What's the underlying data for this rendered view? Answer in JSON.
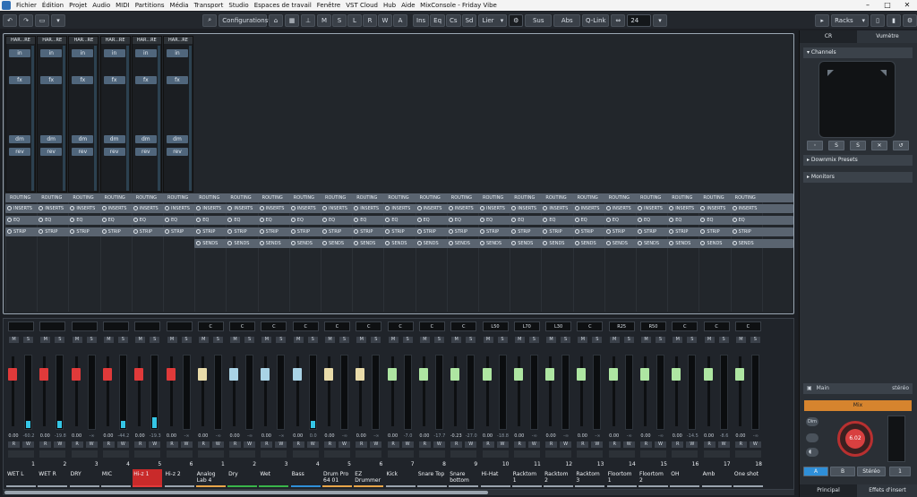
{
  "title_bar": {
    "menu": [
      "Fichier",
      "Édition",
      "Projet",
      "Audio",
      "MIDI",
      "Partitions",
      "Média",
      "Transport",
      "Studio",
      "Espaces de travail",
      "Fenêtre",
      "VST Cloud",
      "Hub",
      "Aide"
    ],
    "window_title": "MixConsole - Friday Vibe",
    "controls": [
      "–",
      "□",
      "✕"
    ]
  },
  "toolbar": {
    "undo": "↶",
    "redo": "↷",
    "configurations_label": "Configurations",
    "filter_buttons": [
      "M",
      "S",
      "L",
      "R",
      "W",
      "A"
    ],
    "section_buttons": [
      "Ins",
      "Eq",
      "Cs",
      "Sd"
    ],
    "link_label": "Lier",
    "sus_label": "Sus",
    "abs_label": "Abs",
    "qlink_label": "Q-Link",
    "channel_width": "24",
    "racks_label": "Racks"
  },
  "upper": {
    "strip_header": "HAR...RE",
    "in_label": "in",
    "fx_label": "fx",
    "dm_label": "dm",
    "rev_label": "rev",
    "routing_label": "ROUTING",
    "inserts_label": "INSERTS",
    "eq_label": "EQ",
    "strip_label": "STRIP",
    "sends_label": "SENDS"
  },
  "channels": [
    {
      "name": "WET L",
      "num": "1",
      "pan": "",
      "fader": "red",
      "meter": 0.1,
      "vol": "0.00",
      "peak": "-60.2",
      "color": "#9aa4ae"
    },
    {
      "name": "WET R",
      "num": "2",
      "pan": "",
      "fader": "red",
      "meter": 0.1,
      "vol": "0.00",
      "peak": "-19.8",
      "color": "#9aa4ae"
    },
    {
      "name": "DRY",
      "num": "3",
      "pan": "",
      "fader": "red",
      "meter": 0,
      "vol": "0.00",
      "peak": "-∞",
      "color": "#9aa4ae"
    },
    {
      "name": "MIC",
      "num": "4",
      "pan": "",
      "fader": "red",
      "meter": 0.1,
      "vol": "0.00",
      "peak": "-44.2",
      "color": "#9aa4ae"
    },
    {
      "name": "Hi-z 1",
      "num": "5",
      "pan": "",
      "fader": "red",
      "meter": 0.15,
      "vol": "0.00",
      "peak": "-19.3",
      "color": "#e23a3a"
    },
    {
      "name": "Hi-z 2",
      "num": "6",
      "pan": "",
      "fader": "red",
      "meter": 0,
      "vol": "0.00",
      "peak": "-∞",
      "color": "#9aa4ae"
    },
    {
      "name": "Analog Lab 4",
      "num": "1",
      "pan": "C",
      "fader": "beige",
      "meter": 0,
      "vol": "0.00",
      "peak": "-∞",
      "color": "#e8a64a"
    },
    {
      "name": "Dry",
      "num": "2",
      "pan": "C",
      "fader": "ltblue",
      "meter": 0,
      "vol": "0.00",
      "peak": "-∞",
      "color": "#39b54a"
    },
    {
      "name": "Wet",
      "num": "3",
      "pan": "C",
      "fader": "ltblue",
      "meter": 0,
      "vol": "0.00",
      "peak": "-∞",
      "color": "#39b54a"
    },
    {
      "name": "Bass",
      "num": "4",
      "pan": "C",
      "fader": "ltblue",
      "meter": 0.1,
      "vol": "0.00",
      "peak": "0.0",
      "color": "#2f8fd8"
    },
    {
      "name": "Drum Pro 64 01",
      "num": "5",
      "pan": "C",
      "fader": "beige",
      "meter": 0,
      "vol": "0.00",
      "peak": "-∞",
      "color": "#e8a64a"
    },
    {
      "name": "EZ Drummer",
      "num": "6",
      "pan": "C",
      "fader": "beige",
      "meter": 0,
      "vol": "0.00",
      "peak": "-∞",
      "color": "#e8a64a"
    },
    {
      "name": "Kick",
      "num": "7",
      "pan": "C",
      "fader": "green",
      "meter": 0,
      "vol": "0.00",
      "peak": "-7.0",
      "color": "#9aa4ae"
    },
    {
      "name": "Snare Top",
      "num": "8",
      "pan": "C",
      "fader": "green",
      "meter": 0,
      "vol": "0.00",
      "peak": "-17.7",
      "color": "#9aa4ae"
    },
    {
      "name": "Snare bottom",
      "num": "9",
      "pan": "C",
      "fader": "green",
      "meter": 0,
      "vol": "-0.23",
      "peak": "-27.0",
      "color": "#9aa4ae"
    },
    {
      "name": "Hi-Hat",
      "num": "10",
      "pan": "L50",
      "fader": "green",
      "meter": 0,
      "vol": "0.00",
      "peak": "-18.8",
      "color": "#9aa4ae"
    },
    {
      "name": "Racktom 1",
      "num": "11",
      "pan": "L70",
      "fader": "green",
      "meter": 0,
      "vol": "0.00",
      "peak": "-∞",
      "color": "#9aa4ae"
    },
    {
      "name": "Racktom 2",
      "num": "12",
      "pan": "L30",
      "fader": "green",
      "meter": 0,
      "vol": "0.00",
      "peak": "-∞",
      "color": "#9aa4ae"
    },
    {
      "name": "Racktom 3",
      "num": "13",
      "pan": "C",
      "fader": "green",
      "meter": 0,
      "vol": "0.00",
      "peak": "-∞",
      "color": "#9aa4ae"
    },
    {
      "name": "Floortom 1",
      "num": "14",
      "pan": "R25",
      "fader": "green",
      "meter": 0,
      "vol": "0.00",
      "peak": "-∞",
      "color": "#9aa4ae"
    },
    {
      "name": "Floortom 2",
      "num": "15",
      "pan": "R50",
      "fader": "green",
      "meter": 0,
      "vol": "0.00",
      "peak": "-∞",
      "color": "#9aa4ae"
    },
    {
      "name": "OH",
      "num": "16",
      "pan": "C",
      "fader": "green",
      "meter": 0,
      "vol": "0.00",
      "peak": "-14.5",
      "color": "#9aa4ae"
    },
    {
      "name": "Amb",
      "num": "17",
      "pan": "C",
      "fader": "green",
      "meter": 0,
      "vol": "0.00",
      "peak": "-8.6",
      "color": "#9aa4ae"
    },
    {
      "name": "One shot",
      "num": "18",
      "pan": "C",
      "fader": "green",
      "meter": 0,
      "vol": "0.00",
      "peak": "-∞",
      "color": "#9aa4ae"
    }
  ],
  "fader_colors": {
    "red": "#e03a3a",
    "beige": "#e9dcaa",
    "ltblue": "#a9d3e6",
    "green": "#aee6a2"
  },
  "right_panel": {
    "tab_cr": "CR",
    "tab_vumetre": "Vumètre",
    "channels_section": "Channels",
    "downmix_section": "Downmix Presets",
    "monitors_section": "Monitors",
    "main_label": "Main",
    "stereo_label": "stéréo",
    "mix_label": "Mix",
    "knob_value": "6.02",
    "dim_label": "Dim",
    "btn_a": "A",
    "btn_b": "B",
    "btn_stereo": "Stéréo",
    "btn_1": "1",
    "tab_principal": "Principal",
    "tab_effets": "Effets d'insert"
  }
}
